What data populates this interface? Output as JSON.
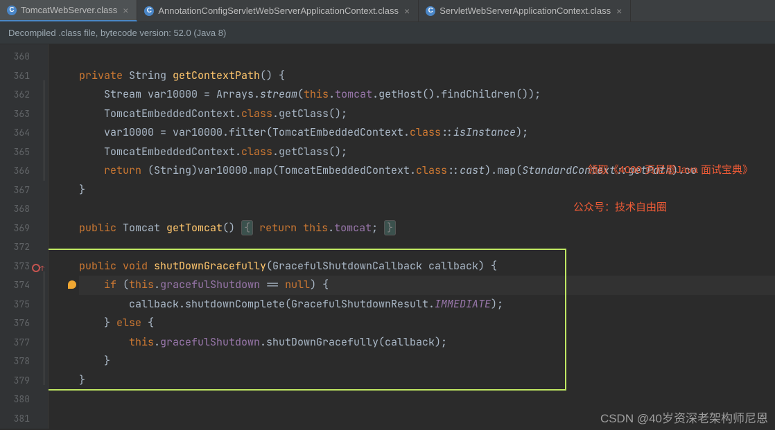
{
  "tabs": [
    {
      "label": "TomcatWebServer.class",
      "active": true
    },
    {
      "label": "AnnotationConfigServletWebServerApplicationContext.class",
      "active": false
    },
    {
      "label": "ServletWebServerApplicationContext.class",
      "active": false
    }
  ],
  "banner": "Decompiled .class file, bytecode version: 52.0 (Java 8)",
  "line_numbers": [
    "360",
    "361",
    "362",
    "363",
    "364",
    "365",
    "366",
    "367",
    "368",
    "369",
    "372",
    "373",
    "374",
    "375",
    "376",
    "377",
    "378",
    "379",
    "380",
    "381"
  ],
  "code": {
    "l361": {
      "kw1": "private ",
      "t1": "String ",
      "m": "getContextPath",
      "t2": "() {"
    },
    "l362": {
      "t1": "    Stream var10000 = Arrays.",
      "s": "stream",
      "t2": "(",
      "kw": "this",
      "t3": ".",
      "f": "tomcat",
      "t4": ".getHost().findChildren());"
    },
    "l363": {
      "t1": "    TomcatEmbeddedContext.",
      "kw": "class",
      "t2": ".getClass();"
    },
    "l364": {
      "t1": "    var10000 = var10000.filter(TomcatEmbeddedContext.",
      "kw": "class",
      "t2": "::",
      "s": "isInstance",
      "t3": ");"
    },
    "l365": {
      "t1": "    TomcatEmbeddedContext.",
      "kw": "class",
      "t2": ".getClass();"
    },
    "l366": {
      "kw1": "    return ",
      "t1": "(String)var10000.map(TomcatEmbeddedContext.",
      "kw2": "class",
      "t2": "::",
      "s1": "cast",
      "t3": ").map(",
      "s2": "StandardContext::getPath",
      "t4": ").co"
    },
    "l367": {
      "t": "}"
    },
    "l369": {
      "kw1": "public ",
      "t1": "Tomcat ",
      "m": "getTomcat",
      "t2": "() ",
      "f1": "{",
      "t3": " ",
      "kw2": "return this",
      "t4": ".",
      "fld": "tomcat",
      "t5": "; ",
      "f2": "}"
    },
    "l373": {
      "kw1": "public void ",
      "m": "shutDownGracefully",
      "t1": "(GracefulShutdownCallback callback) {"
    },
    "l374": {
      "kw1": "    if ",
      "t1": "(",
      "kw2": "this",
      "t2": ".",
      "f": "gracefulShutdown",
      "t3": " == ",
      "kw3": "null",
      "t4": ") {"
    },
    "l375": {
      "t1": "        callback.shutdownComplete(GracefulShutdownResult.",
      "c": "IMMEDIATE",
      "t2": ");"
    },
    "l376": {
      "t1": "    } ",
      "kw": "else ",
      "t2": "{"
    },
    "l377": {
      "kw": "        this",
      "t1": ".",
      "f": "gracefulShutdown",
      "t2": ".shutDownGracefully(callback);"
    },
    "l378": {
      "t": "    }"
    },
    "l379": {
      "t": "}"
    }
  },
  "watermarks": {
    "w1": "领取《4000 页尼恩Java 面试宝典》",
    "w2": "公众号：技术自由圈",
    "csdn": "CSDN @40岁资深老架构师尼恩"
  }
}
